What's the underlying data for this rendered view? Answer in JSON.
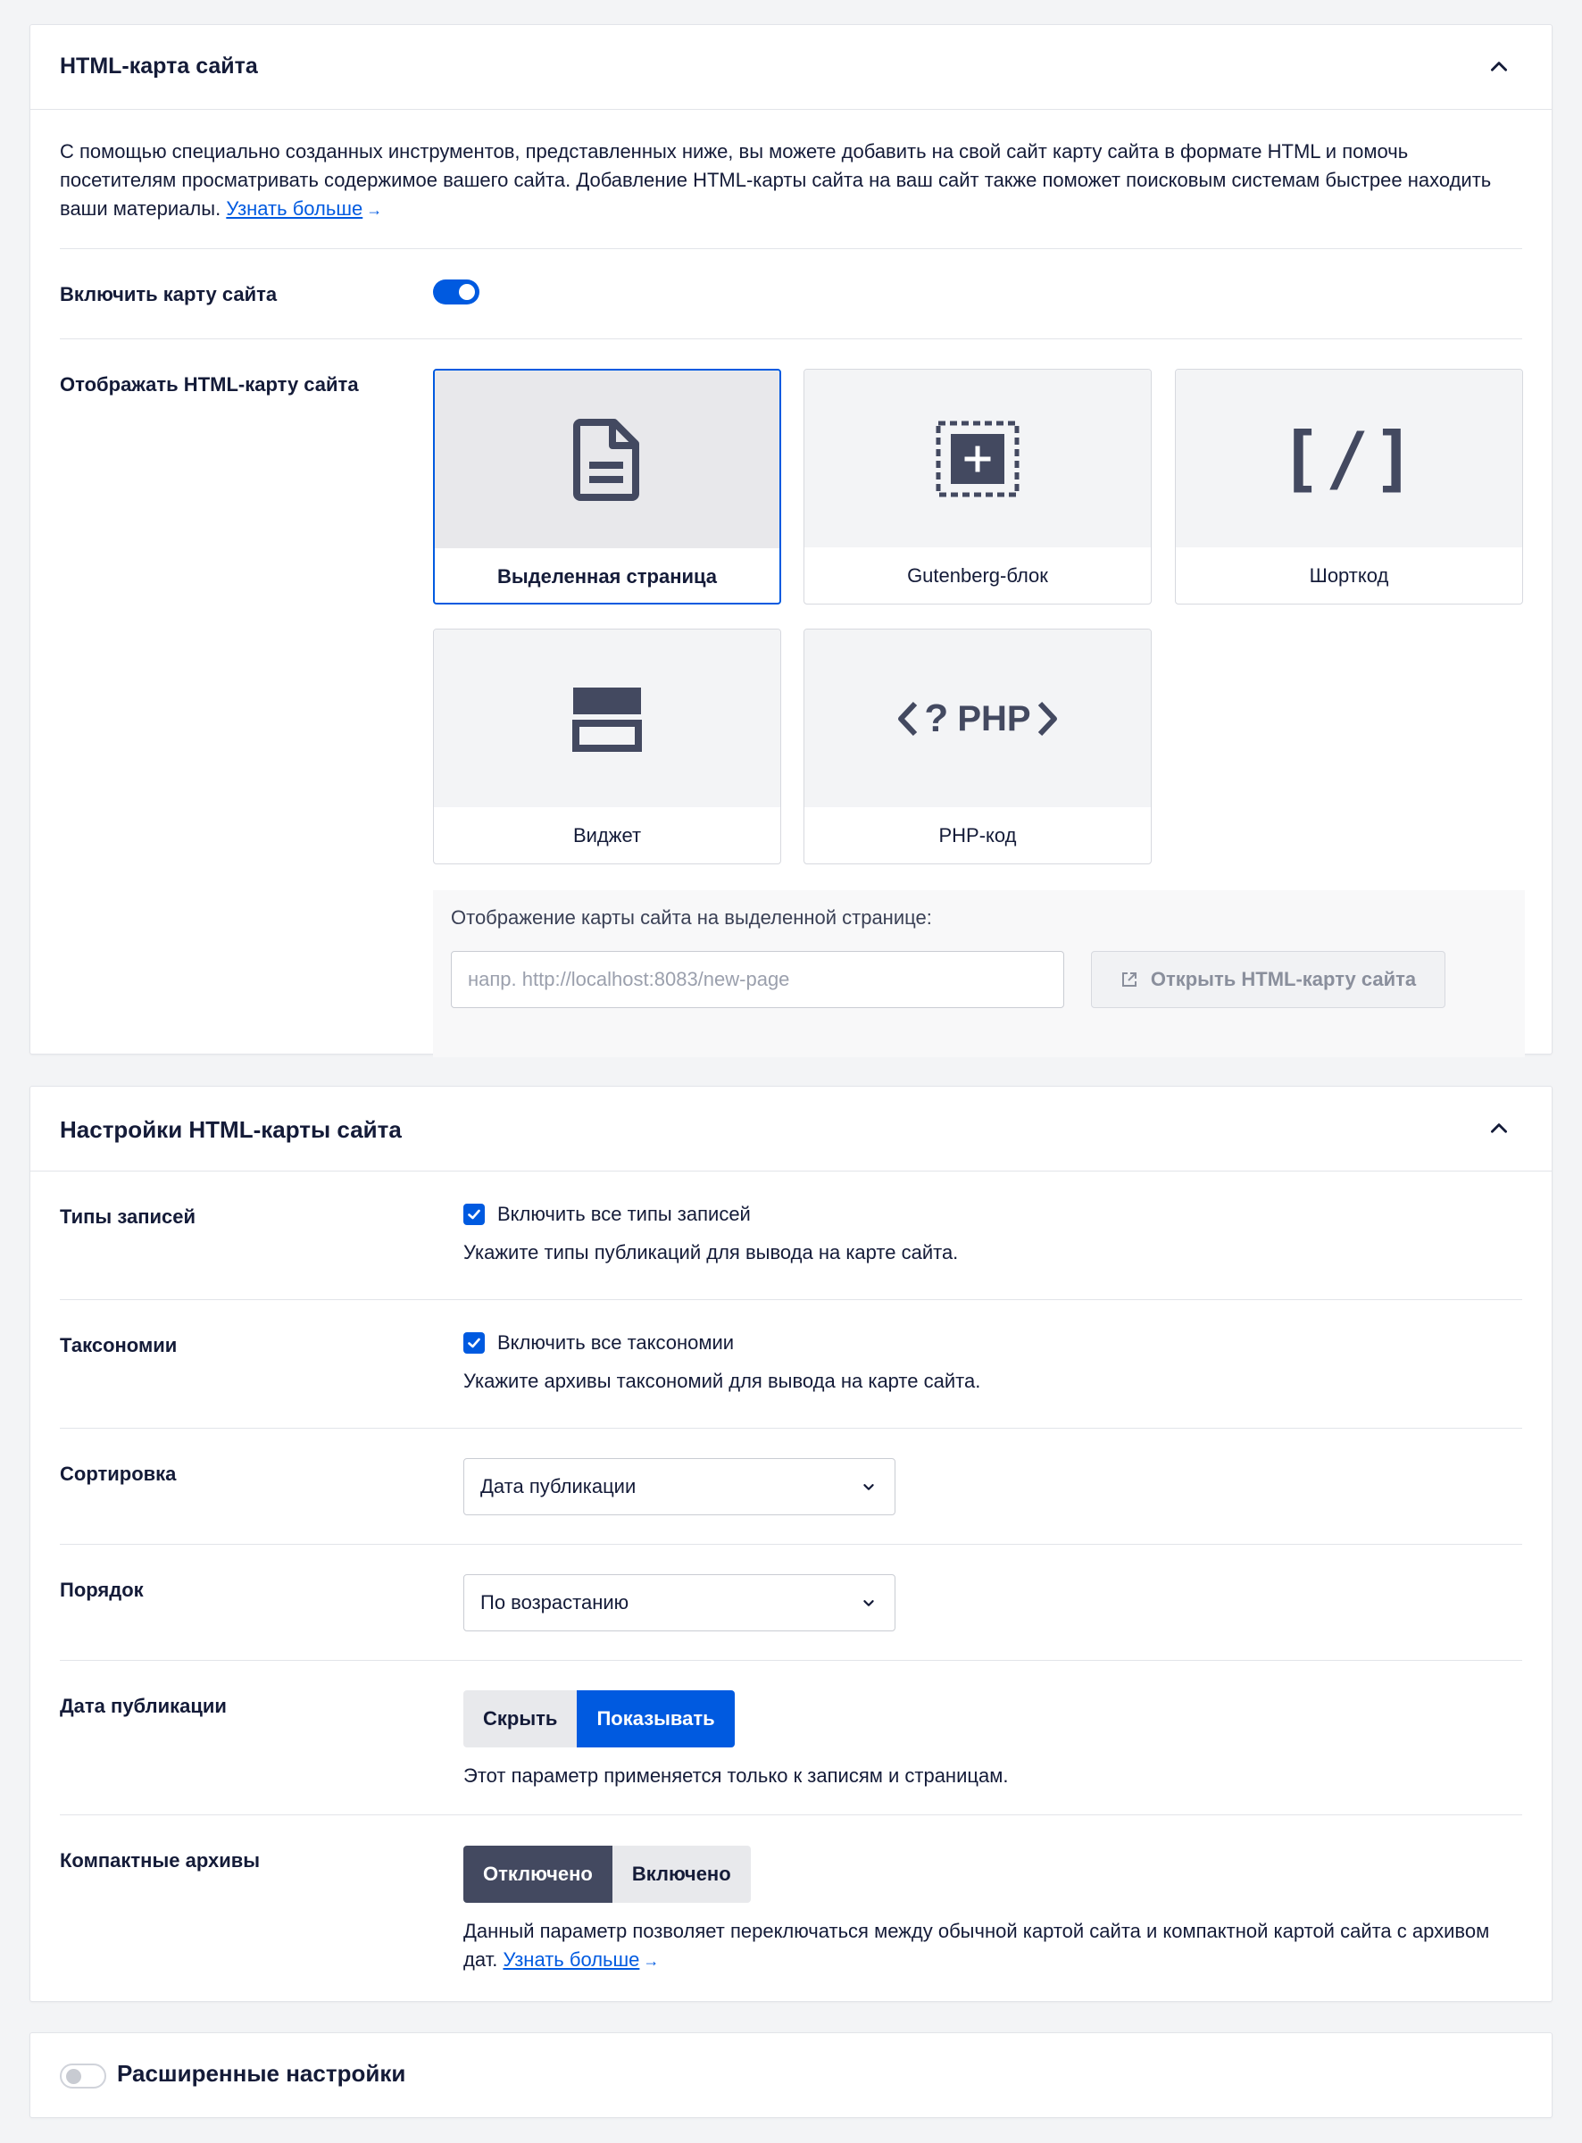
{
  "sitemap_card": {
    "title": "HTML-карта сайта",
    "intro_text": "С помощью специально созданных инструментов, представленных ниже, вы можете добавить на свой сайт карту сайта в формате HTML и помочь посетителям просматривать содержимое вашего сайта. Добавление HTML-карты сайта на ваш сайт также поможет поисковым системам быстрее находить ваши материалы.",
    "learn_more": "Узнать больше",
    "arrow": "→",
    "enable_label": "Включить карту сайта",
    "enable_state": "on",
    "display_label": "Отображать HTML-карту сайта",
    "tiles": [
      {
        "label": "Выделенная страница",
        "icon": "document-icon",
        "selected": true
      },
      {
        "label": "Gutenberg-блок",
        "icon": "block-add-icon",
        "selected": false
      },
      {
        "label": "Шорткод",
        "icon": "shortcode-icon",
        "selected": false
      },
      {
        "label": "Виджет",
        "icon": "widget-icon",
        "selected": false
      },
      {
        "label": "PHP-код",
        "icon": "php-code-icon",
        "selected": false
      }
    ],
    "shortcode_glyph": "[/]",
    "php_glyph": "PHP",
    "php_q": "?",
    "preview_label": "Отображение карты сайта на выделенной странице:",
    "url_placeholder": "напр. http://localhost:8083/new-page",
    "url_value": "",
    "open_button": "Открыть HTML-карту сайта"
  },
  "settings_card": {
    "title": "Настройки HTML-карты сайта",
    "post_types": {
      "label": "Типы записей",
      "checkbox": "Включить все типы записей",
      "checked": true,
      "help": "Укажите типы публикаций для вывода на карте сайта."
    },
    "taxonomies": {
      "label": "Таксономии",
      "checkbox": "Включить все таксономии",
      "checked": true,
      "help": "Укажите архивы таксономий для вывода на карте сайта."
    },
    "sort": {
      "label": "Сортировка",
      "value": "Дата публикации"
    },
    "order": {
      "label": "Порядок",
      "value": "По возрастанию"
    },
    "publish_date": {
      "label": "Дата публикации",
      "options": [
        "Скрыть",
        "Показывать"
      ],
      "selected": "Показывать",
      "help": "Этот параметр применяется только к записям и страницам."
    },
    "compact": {
      "label": "Компактные архивы",
      "options": [
        "Отключено",
        "Включено"
      ],
      "selected": "Отключено",
      "help": "Данный параметр позволяет переключаться между обычной картой сайта и компактной картой сайта с архивом дат.",
      "learn_more": "Узнать больше",
      "arrow": "→"
    }
  },
  "advanced_card": {
    "title": "Расширенные настройки",
    "toggle_state": "off"
  },
  "colors": {
    "accent": "#005ae0",
    "dark": "#434960",
    "text": "#141b38",
    "background": "#f3f4f6"
  }
}
